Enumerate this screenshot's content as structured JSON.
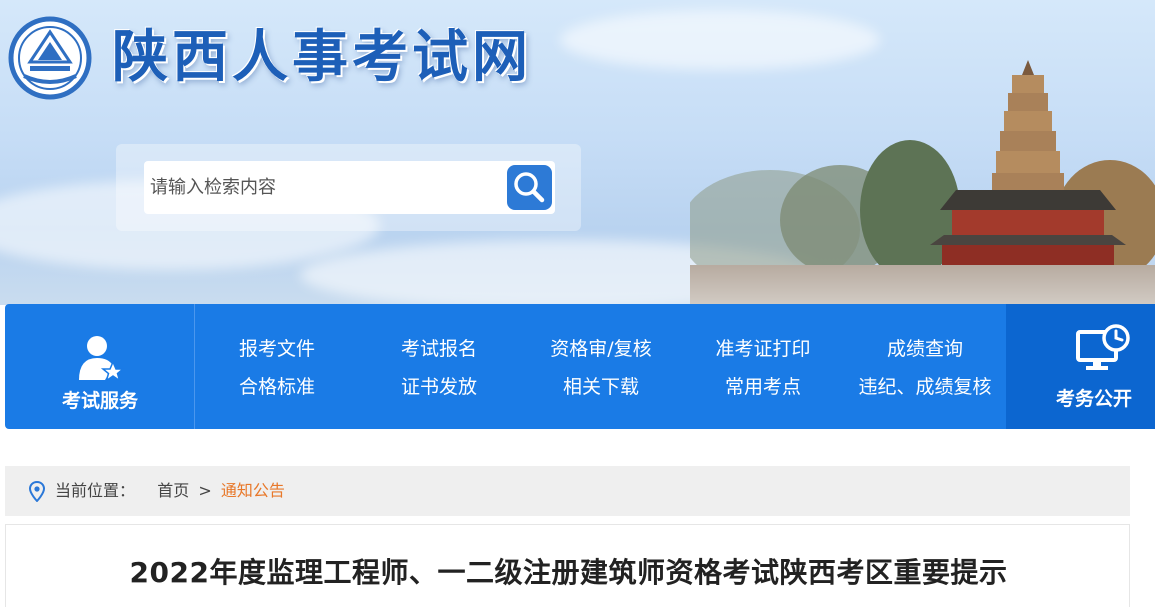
{
  "header": {
    "site_title": "陕西人事考试网",
    "logo_icon": "shaanxi-emblem-icon",
    "search": {
      "placeholder": "请输入检索内容",
      "button_icon": "search-icon"
    }
  },
  "nav": {
    "left": {
      "label": "考试服务",
      "icon": "person-star-icon"
    },
    "links": [
      "报考文件",
      "考试报名",
      "资格审/复核",
      "准考证打印",
      "成绩查询",
      "合格标准",
      "证书发放",
      "相关下载",
      "常用考点",
      "违纪、成绩复核"
    ],
    "right": {
      "label": "考务公开",
      "icon": "monitor-clock-icon"
    }
  },
  "breadcrumb": {
    "prefix": "当前位置：",
    "home": "首页",
    "separator": ">",
    "current": "通知公告",
    "icon": "location-pin-icon"
  },
  "article": {
    "title": "2022年度监理工程师、一二级注册建筑师资格考试陕西考区重要提示"
  },
  "colors": {
    "nav_blue": "#1a7be6",
    "nav_dark_blue": "#0c66d0",
    "title_blue": "#1d5fb8",
    "breadcrumb_accent": "#e8782a"
  }
}
